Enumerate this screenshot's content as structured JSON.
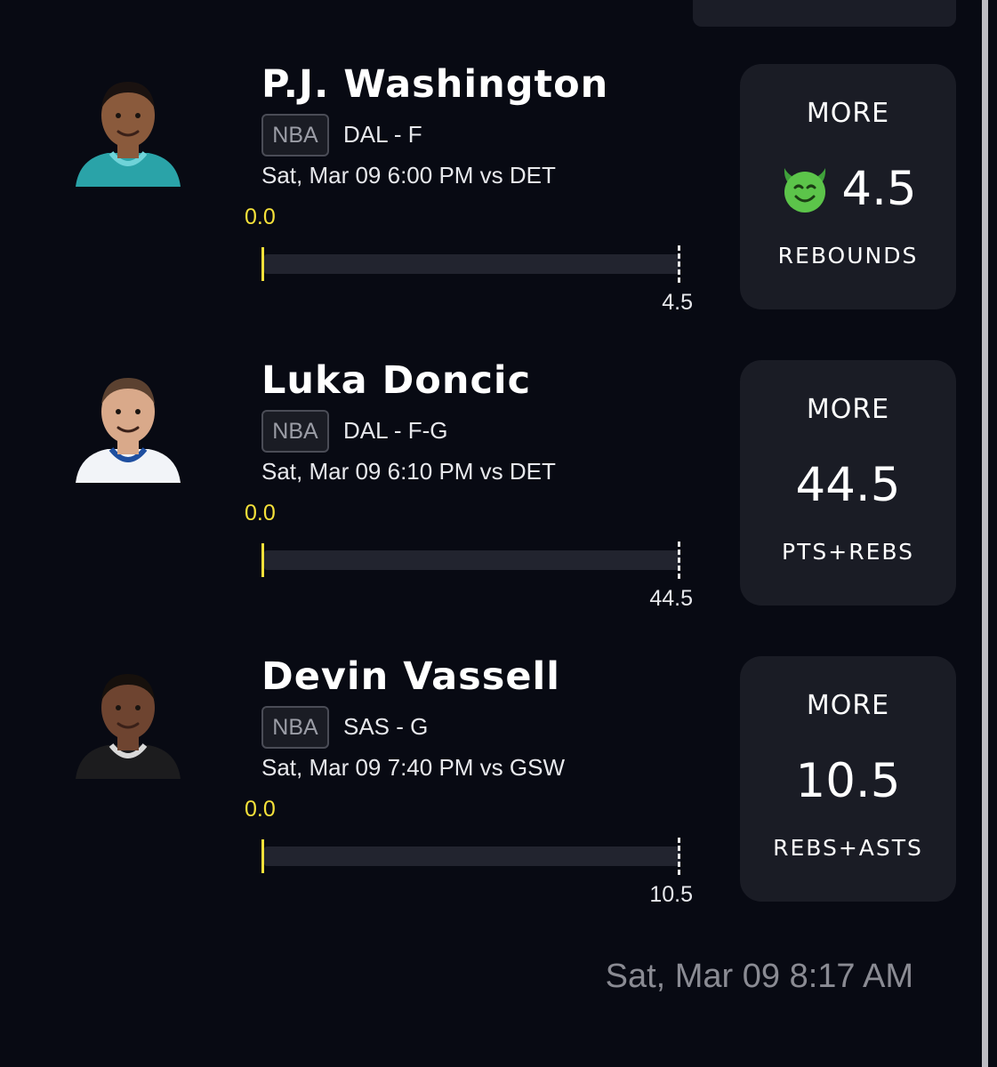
{
  "top_button": {
    "label": ""
  },
  "picks": [
    {
      "player_name": "P.J. Washington",
      "league": "NBA",
      "team_position": "DAL - F",
      "game_time": "Sat, Mar 09 6:00 PM  vs DET",
      "current_value": "0.0",
      "progress_fraction": 0,
      "target_label": "4.5",
      "direction": "MORE",
      "line_value": "4.5",
      "stat_type": "REBOUNDS",
      "icon": "devil-emoji-icon",
      "jersey_color": "#2aa3a8",
      "trim_color": "#6fd3d8"
    },
    {
      "player_name": "Luka Doncic",
      "league": "NBA",
      "team_position": "DAL - F-G",
      "game_time": "Sat, Mar 09 6:10 PM  vs DET",
      "current_value": "0.0",
      "progress_fraction": 0,
      "target_label": "44.5",
      "direction": "MORE",
      "line_value": "44.5",
      "stat_type": "PTS+REBS",
      "icon": null,
      "jersey_color": "#f2f4f8",
      "trim_color": "#1f4fa0"
    },
    {
      "player_name": "Devin Vassell",
      "league": "NBA",
      "team_position": "SAS - G",
      "game_time": "Sat, Mar 09 7:40 PM  vs GSW",
      "current_value": "0.0",
      "progress_fraction": 0,
      "target_label": "10.5",
      "direction": "MORE",
      "line_value": "10.5",
      "stat_type": "REBS+ASTS",
      "icon": null,
      "jersey_color": "#1c1c1e",
      "trim_color": "#d9d9d9"
    }
  ],
  "footer_timestamp": "Sat, Mar 09 8:17 AM",
  "colors": {
    "background": "#080a13",
    "card": "#1a1c25",
    "accent": "#f5e13a",
    "muted_text": "#8a8b93"
  }
}
